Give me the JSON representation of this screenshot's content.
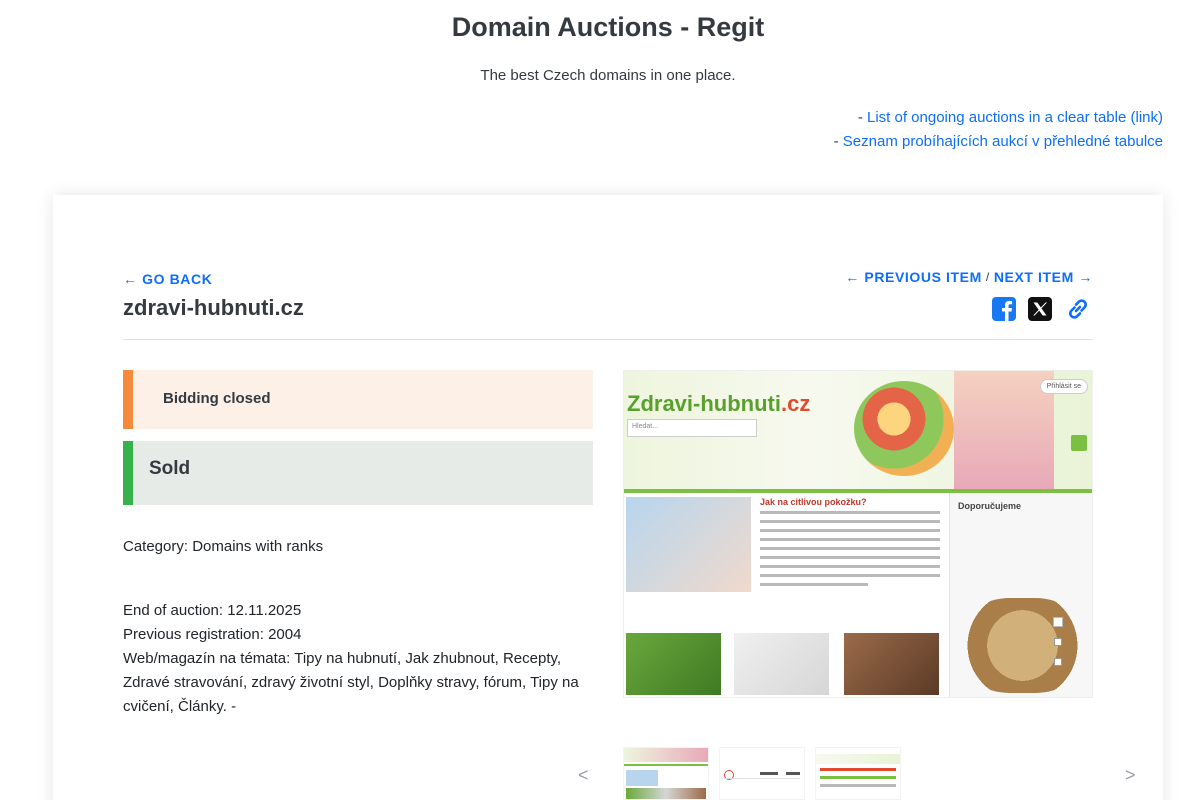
{
  "header": {
    "title": "Domain Auctions - Regit",
    "subtitle": "The best Czech domains in one place.",
    "links": [
      {
        "prefix": "- ",
        "label": "List of ongoing auctions in a clear table (link)"
      },
      {
        "prefix": "- ",
        "label": "Seznam probíhajících aukcí v přehledné tabulce"
      }
    ]
  },
  "nav": {
    "go_back": "GO BACK",
    "previous": "PREVIOUS ITEM",
    "separator": "/",
    "next": "NEXT ITEM"
  },
  "item": {
    "domain": "zdravi-hubnuti.cz",
    "status_closed": "Bidding closed",
    "status_sold": "Sold",
    "category": "Category: Domains with ranks",
    "end_of_auction": "End of auction: 12.11.2025",
    "previous_registration": "Previous registration: 2004",
    "description": "Web/magazín na témata: Tipy na hubnutí, Jak zhubnout, Recepty, Zdravé stravování, zdravý životní styl, Doplňky stravy, fórum, Tipy na cvičení, Články. -"
  },
  "share": {
    "icons": [
      "facebook-icon",
      "x-icon",
      "link-icon"
    ],
    "facebook_color": "#1877f2",
    "link_color": "#0d6efd"
  },
  "gallery": {
    "screenshot": {
      "logo_main": "Zdravi-hubnuti",
      "logo_tld": ".cz",
      "search_placeholder": "Hledat...",
      "login": "Přihlásit se",
      "article_title": "Jak na citlivou pokožku?",
      "aside_title": "Doporučujeme"
    },
    "dots": 3,
    "prev": "<",
    "next": ">"
  },
  "colors": {
    "accent": "#0d6efd",
    "closed_bar": "#f58a3c",
    "sold_bar": "#36b24a"
  }
}
